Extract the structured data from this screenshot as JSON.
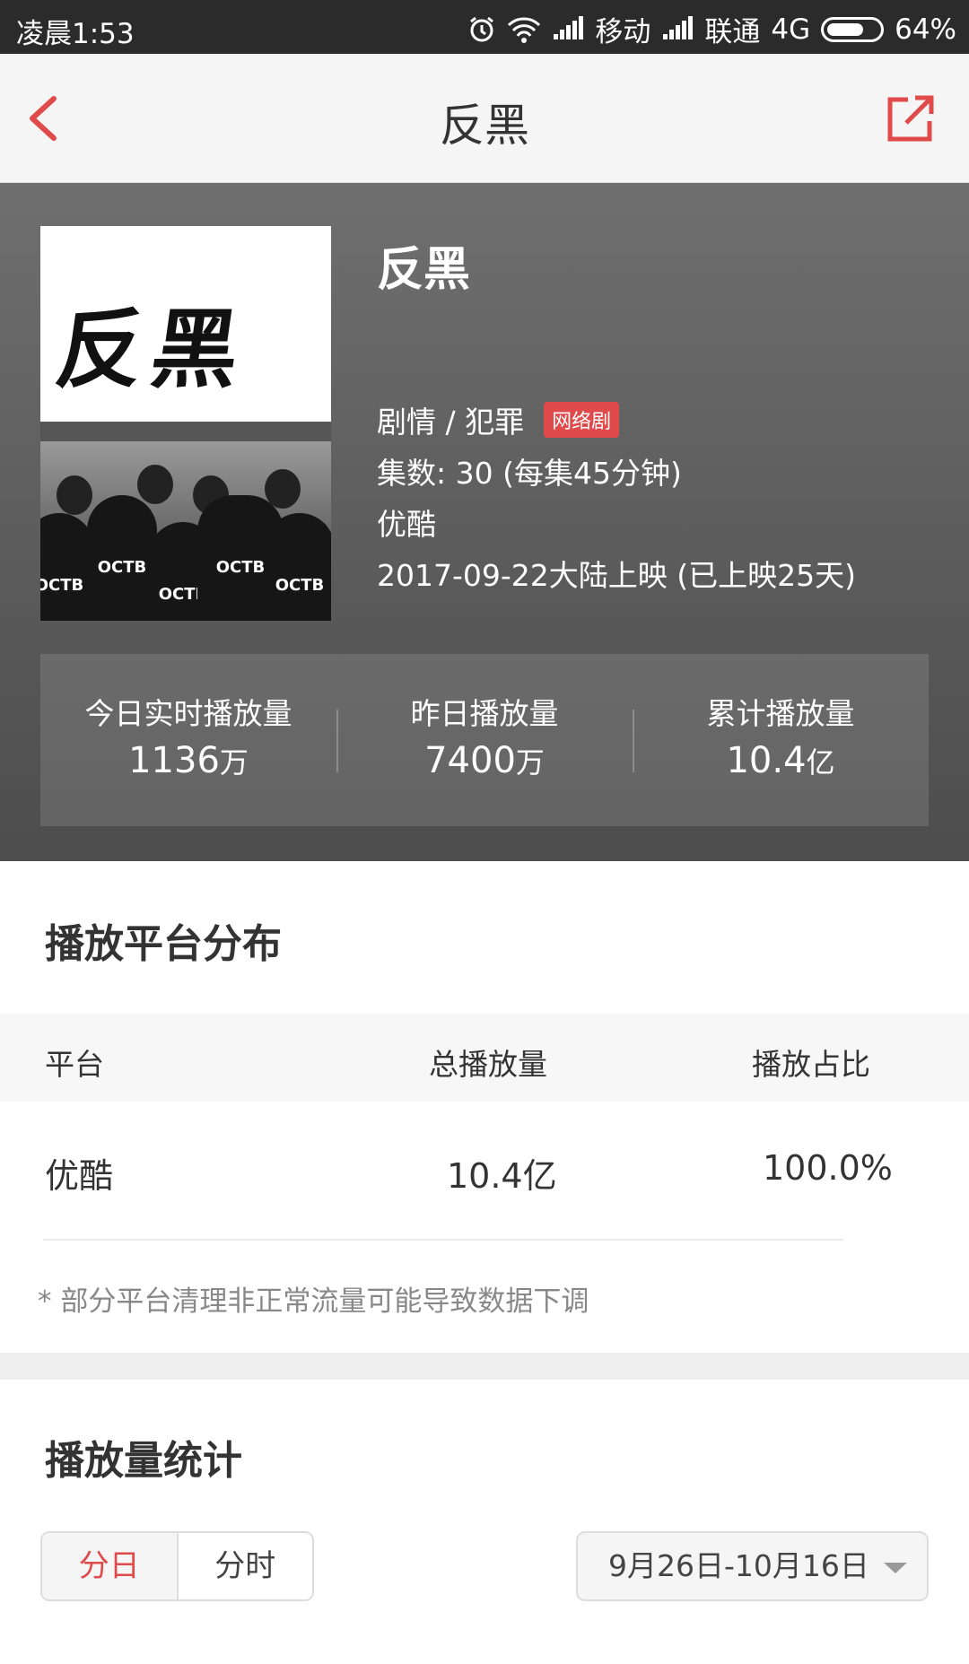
{
  "status_bar": {
    "time": "凌晨1:53",
    "carrier1": "移动",
    "carrier2": "联通",
    "network": "4G",
    "battery": "64%"
  },
  "navbar": {
    "title": "反黑",
    "back_icon": "chevron-left-icon",
    "share_icon": "share-external-icon",
    "accent_color": "#e14a4a"
  },
  "show": {
    "title": "反黑",
    "poster_calligraphy": "反黑",
    "poster_badges": [
      "OCTB",
      "OCTB",
      "OCTB",
      "OCTB",
      "OCTB"
    ],
    "genre": "剧情 / 犯罪",
    "tag": "网络剧",
    "episodes": "集数: 30   (每集45分钟)",
    "platform": "优酷",
    "release": "2017-09-22大陆上映 (已上映25天)"
  },
  "stats": [
    {
      "label": "今日实时播放量",
      "value": "1136",
      "unit": "万"
    },
    {
      "label": "昨日播放量",
      "value": "7400",
      "unit": "万"
    },
    {
      "label": "累计播放量",
      "value": "10.4",
      "unit": "亿"
    }
  ],
  "distribution": {
    "title": "播放平台分布",
    "headers": {
      "platform": "平台",
      "total": "总播放量",
      "share": "播放占比"
    },
    "rows": [
      {
        "platform": "优酷",
        "total": "10.4亿",
        "share": "100.0%"
      }
    ],
    "note": "* 部分平台清理非正常流量可能导致数据下调"
  },
  "play_stats": {
    "title": "播放量统计",
    "tabs": [
      "分日",
      "分时"
    ],
    "active_tab": "分日",
    "date_range": "9月26日-10月16日"
  }
}
